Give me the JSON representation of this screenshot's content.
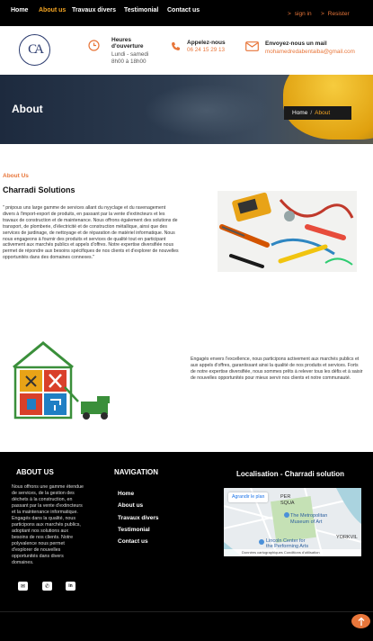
{
  "nav": {
    "items": [
      "Home",
      "About us",
      "Travaux divers",
      "Testimonial",
      "Contact us"
    ],
    "active_index": 1,
    "sign_in": "sign in",
    "register": "Resister"
  },
  "header": {
    "logo_text": "CA",
    "hours": {
      "title": "Heures d'ouverture",
      "line1": "Lundi - samedi",
      "line2": "8h00 à 18h00",
      "icon": "clock-icon"
    },
    "phone": {
      "title": "Appelez-nous",
      "value": "06 24 15 29 13",
      "icon": "phone-icon"
    },
    "email": {
      "title": "Envoyez-nous un mail",
      "value": "mohamedredabentaiba@gmail.com",
      "icon": "envelope-icon"
    }
  },
  "hero": {
    "title": "About",
    "breadcrumb": {
      "home": "Home",
      "separator": "/",
      "current": "About"
    }
  },
  "about": {
    "label": "About Us",
    "company": "Charradi Solutions",
    "paragraph1": "\" pnipous uns large gamme de services allant du nyyclage et du ravenagement divers à l'import-export de produits, en passant par la vente d'extincteurs et les travaux de construction et de maintenance. Nous offrons également des solutions de transport, de plomberie, d'électricité et de construction métallique, ainsi que des services de jardinage, de nettoyage et de réparation de matériel informatique. Nous nous engageons à fournir des produits et services de qualité tout en participant activement aux marchés publics et appels d'offres. Notre expertise diversifiée nous permet de répondre aux besoins spécifiques de nos clients et d'explorer de nouvelles opportunités dans des domaines connexes.\"",
    "paragraph2": "Engagés envers l'excellence, nous participons activement aux marchés publics et aux appels d'offres, garantissant ainsi la qualité de nos produits et services. Forts de notre expertise diversifiée, nous sommes prêts à relever tous les défis et à saisir de nouvelles opportunités pour mieux servir nos clients et notre communauté."
  },
  "footer": {
    "about_title": "ABOUT US",
    "about_text": "Nous offrons une gamme étendue de services, de la gestion des déchets à la construction, en passant par la vente d'extincteurs et la maintenance informatique. Engagés dans la qualité, nous participons aux marchés publics, adoptant nos solutions aux besoins de nos clients. Notre polyvalence nous permet d'explorer de nouvelles opportunités dans divers domaines.",
    "nav_title": "NAVIGATION",
    "nav_links": [
      "Home",
      "About us",
      "Travaux divers",
      "Testimonial",
      "Contact us"
    ],
    "map_title": "Localisation - Charradi solution",
    "map": {
      "button": "Agrandir le plan",
      "labels": [
        "PER",
        "SQUA",
        "The Metropolitan",
        "Museum of Art",
        "Lincoln Center for",
        "the Performing Arts",
        "YORKVIL"
      ],
      "footer": "Données cartographiques   Conditions d'utilisation"
    },
    "social_icons": [
      "envelope-icon",
      "phone-icon",
      "linkedin-icon"
    ]
  },
  "colors": {
    "accent": "#e8763a",
    "active": "#f5a623",
    "dark": "#000000"
  }
}
